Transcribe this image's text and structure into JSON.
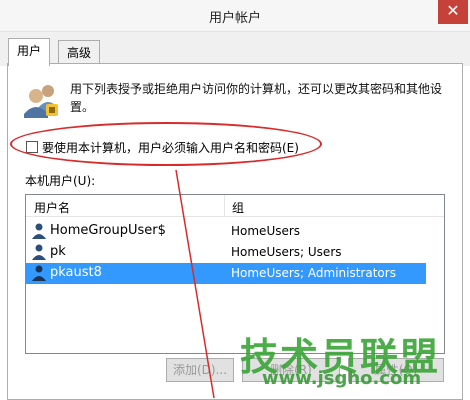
{
  "window": {
    "title": "用户帐户",
    "close_glyph": "✕"
  },
  "tabs": [
    {
      "label": "用户",
      "active": true
    },
    {
      "label": "高级",
      "active": false
    }
  ],
  "description": "用下列表授予或拒绝用户访问你的计算机，还可以更改其密码和其他设置。",
  "require_login": {
    "label": "要使用本计算机，用户必须输入用户名和密码(E)",
    "checked": false
  },
  "users_list": {
    "label": "本机用户(U):",
    "columns": [
      "用户名",
      "组"
    ],
    "rows": [
      {
        "name": "HomeGroupUser$",
        "group": "HomeUsers",
        "selected": false
      },
      {
        "name": "pk",
        "group": "HomeUsers; Users",
        "selected": false
      },
      {
        "name": "pkaust8",
        "group": "HomeUsers; Administrators",
        "selected": true
      }
    ]
  },
  "buttons": {
    "add": "添加(D)...",
    "remove": "删除(R)",
    "properties": "属性(O)"
  },
  "watermark": {
    "text": "技术员联盟",
    "url": "www.jsgho.com"
  },
  "colors": {
    "selection": "#3399ff",
    "annotation": "#d82c2c",
    "watermark": "#3aa538"
  }
}
